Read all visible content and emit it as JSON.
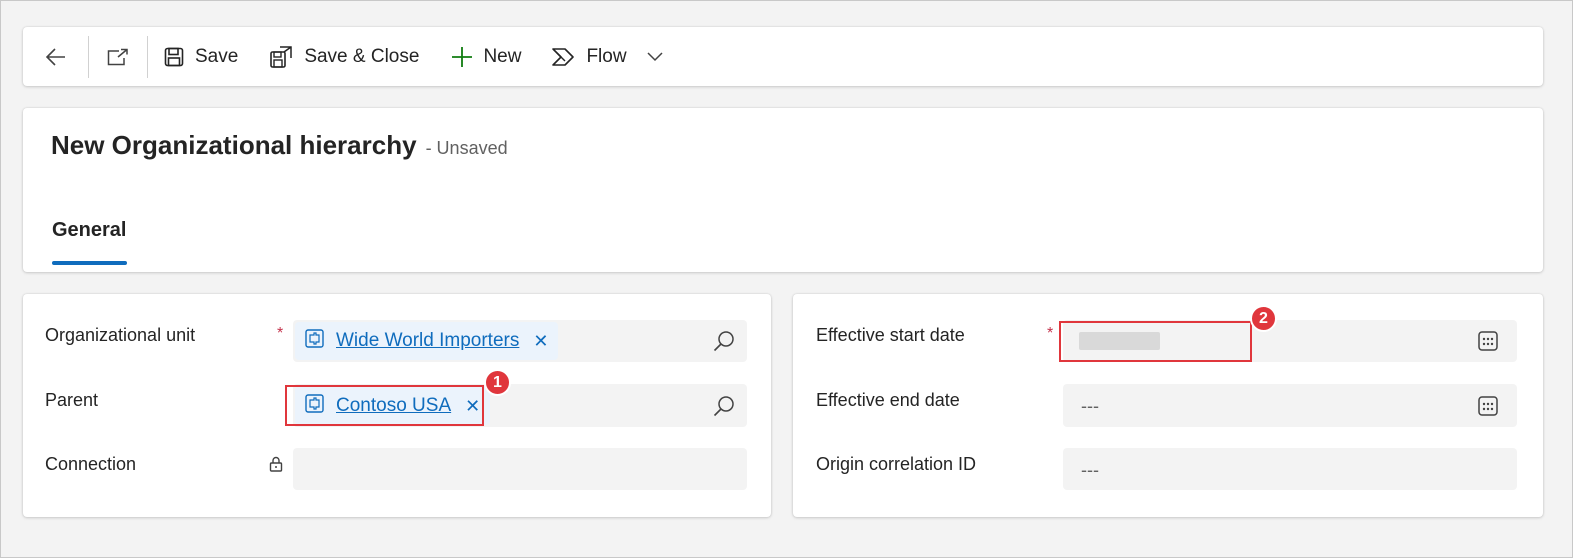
{
  "toolbar": {
    "save_label": "Save",
    "save_close_label": "Save & Close",
    "new_label": "New",
    "flow_label": "Flow"
  },
  "header": {
    "title": "New Organizational hierarchy",
    "status": "- Unsaved",
    "tabs": [
      {
        "label": "General",
        "selected": true
      }
    ]
  },
  "form_left": {
    "org_unit": {
      "label": "Organizational unit",
      "required": "*",
      "value": "Wide World Importers"
    },
    "parent": {
      "label": "Parent",
      "value": "Contoso USA"
    },
    "connection": {
      "label": "Connection",
      "value": ""
    }
  },
  "form_right": {
    "start_date": {
      "label": "Effective start date",
      "required": "*",
      "value": ""
    },
    "end_date": {
      "label": "Effective end date",
      "value": "---"
    },
    "origin": {
      "label": "Origin correlation ID",
      "value": "---"
    }
  },
  "callouts": [
    "1",
    "2"
  ],
  "colors": {
    "accent": "#0f6cbd",
    "required": "#c4314b",
    "callout": "#e0363c",
    "new_icon": "#107c10"
  }
}
